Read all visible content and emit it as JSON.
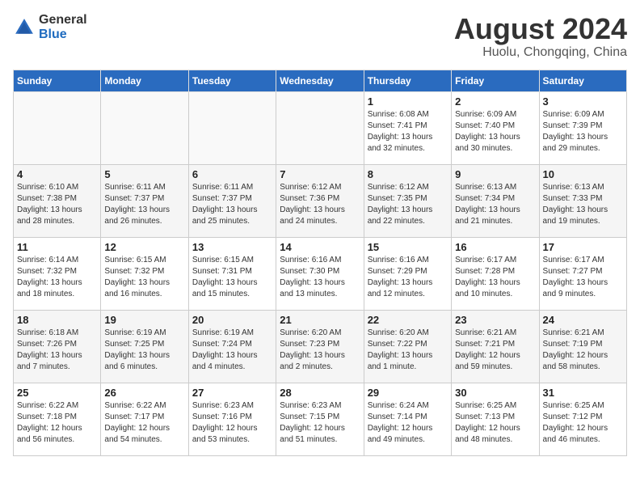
{
  "logo": {
    "general": "General",
    "blue": "Blue"
  },
  "title": {
    "month_year": "August 2024",
    "location": "Huolu, Chongqing, China"
  },
  "weekdays": [
    "Sunday",
    "Monday",
    "Tuesday",
    "Wednesday",
    "Thursday",
    "Friday",
    "Saturday"
  ],
  "weeks": [
    [
      {
        "day": "",
        "info": ""
      },
      {
        "day": "",
        "info": ""
      },
      {
        "day": "",
        "info": ""
      },
      {
        "day": "",
        "info": ""
      },
      {
        "day": "1",
        "info": "Sunrise: 6:08 AM\nSunset: 7:41 PM\nDaylight: 13 hours\nand 32 minutes."
      },
      {
        "day": "2",
        "info": "Sunrise: 6:09 AM\nSunset: 7:40 PM\nDaylight: 13 hours\nand 30 minutes."
      },
      {
        "day": "3",
        "info": "Sunrise: 6:09 AM\nSunset: 7:39 PM\nDaylight: 13 hours\nand 29 minutes."
      }
    ],
    [
      {
        "day": "4",
        "info": "Sunrise: 6:10 AM\nSunset: 7:38 PM\nDaylight: 13 hours\nand 28 minutes."
      },
      {
        "day": "5",
        "info": "Sunrise: 6:11 AM\nSunset: 7:37 PM\nDaylight: 13 hours\nand 26 minutes."
      },
      {
        "day": "6",
        "info": "Sunrise: 6:11 AM\nSunset: 7:37 PM\nDaylight: 13 hours\nand 25 minutes."
      },
      {
        "day": "7",
        "info": "Sunrise: 6:12 AM\nSunset: 7:36 PM\nDaylight: 13 hours\nand 24 minutes."
      },
      {
        "day": "8",
        "info": "Sunrise: 6:12 AM\nSunset: 7:35 PM\nDaylight: 13 hours\nand 22 minutes."
      },
      {
        "day": "9",
        "info": "Sunrise: 6:13 AM\nSunset: 7:34 PM\nDaylight: 13 hours\nand 21 minutes."
      },
      {
        "day": "10",
        "info": "Sunrise: 6:13 AM\nSunset: 7:33 PM\nDaylight: 13 hours\nand 19 minutes."
      }
    ],
    [
      {
        "day": "11",
        "info": "Sunrise: 6:14 AM\nSunset: 7:32 PM\nDaylight: 13 hours\nand 18 minutes."
      },
      {
        "day": "12",
        "info": "Sunrise: 6:15 AM\nSunset: 7:32 PM\nDaylight: 13 hours\nand 16 minutes."
      },
      {
        "day": "13",
        "info": "Sunrise: 6:15 AM\nSunset: 7:31 PM\nDaylight: 13 hours\nand 15 minutes."
      },
      {
        "day": "14",
        "info": "Sunrise: 6:16 AM\nSunset: 7:30 PM\nDaylight: 13 hours\nand 13 minutes."
      },
      {
        "day": "15",
        "info": "Sunrise: 6:16 AM\nSunset: 7:29 PM\nDaylight: 13 hours\nand 12 minutes."
      },
      {
        "day": "16",
        "info": "Sunrise: 6:17 AM\nSunset: 7:28 PM\nDaylight: 13 hours\nand 10 minutes."
      },
      {
        "day": "17",
        "info": "Sunrise: 6:17 AM\nSunset: 7:27 PM\nDaylight: 13 hours\nand 9 minutes."
      }
    ],
    [
      {
        "day": "18",
        "info": "Sunrise: 6:18 AM\nSunset: 7:26 PM\nDaylight: 13 hours\nand 7 minutes."
      },
      {
        "day": "19",
        "info": "Sunrise: 6:19 AM\nSunset: 7:25 PM\nDaylight: 13 hours\nand 6 minutes."
      },
      {
        "day": "20",
        "info": "Sunrise: 6:19 AM\nSunset: 7:24 PM\nDaylight: 13 hours\nand 4 minutes."
      },
      {
        "day": "21",
        "info": "Sunrise: 6:20 AM\nSunset: 7:23 PM\nDaylight: 13 hours\nand 2 minutes."
      },
      {
        "day": "22",
        "info": "Sunrise: 6:20 AM\nSunset: 7:22 PM\nDaylight: 13 hours\nand 1 minute."
      },
      {
        "day": "23",
        "info": "Sunrise: 6:21 AM\nSunset: 7:21 PM\nDaylight: 12 hours\nand 59 minutes."
      },
      {
        "day": "24",
        "info": "Sunrise: 6:21 AM\nSunset: 7:19 PM\nDaylight: 12 hours\nand 58 minutes."
      }
    ],
    [
      {
        "day": "25",
        "info": "Sunrise: 6:22 AM\nSunset: 7:18 PM\nDaylight: 12 hours\nand 56 minutes."
      },
      {
        "day": "26",
        "info": "Sunrise: 6:22 AM\nSunset: 7:17 PM\nDaylight: 12 hours\nand 54 minutes."
      },
      {
        "day": "27",
        "info": "Sunrise: 6:23 AM\nSunset: 7:16 PM\nDaylight: 12 hours\nand 53 minutes."
      },
      {
        "day": "28",
        "info": "Sunrise: 6:23 AM\nSunset: 7:15 PM\nDaylight: 12 hours\nand 51 minutes."
      },
      {
        "day": "29",
        "info": "Sunrise: 6:24 AM\nSunset: 7:14 PM\nDaylight: 12 hours\nand 49 minutes."
      },
      {
        "day": "30",
        "info": "Sunrise: 6:25 AM\nSunset: 7:13 PM\nDaylight: 12 hours\nand 48 minutes."
      },
      {
        "day": "31",
        "info": "Sunrise: 6:25 AM\nSunset: 7:12 PM\nDaylight: 12 hours\nand 46 minutes."
      }
    ]
  ]
}
